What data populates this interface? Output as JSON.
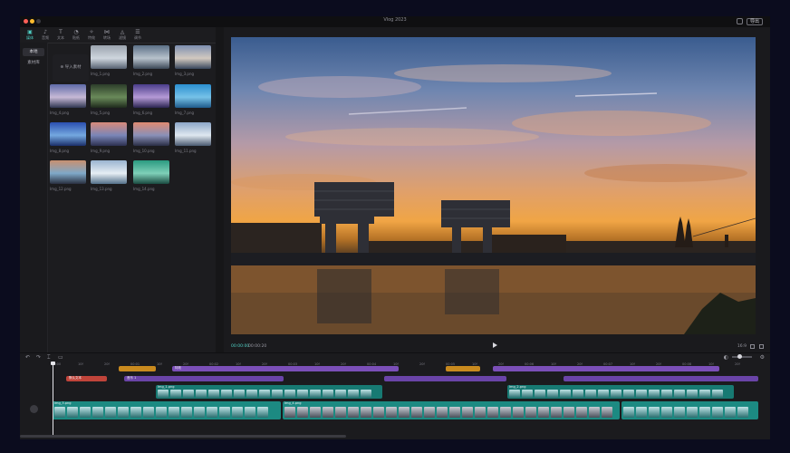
{
  "window": {
    "title": "Vlog 2023",
    "export_label": "导出"
  },
  "media": {
    "tabs": [
      {
        "label": "媒体",
        "glyph": "▣",
        "icon": "media-icon"
      },
      {
        "label": "音频",
        "glyph": "♪",
        "icon": "audio-icon"
      },
      {
        "label": "文本",
        "glyph": "T",
        "icon": "text-icon"
      },
      {
        "label": "贴纸",
        "glyph": "◔",
        "icon": "sticker-icon"
      },
      {
        "label": "特效",
        "glyph": "✧",
        "icon": "effects-icon"
      },
      {
        "label": "转场",
        "glyph": "⋈",
        "icon": "transition-icon"
      },
      {
        "label": "滤镜",
        "glyph": "◬",
        "icon": "filter-icon"
      },
      {
        "label": "调节",
        "glyph": "☰",
        "icon": "adjust-icon"
      }
    ],
    "side_items": [
      "本地",
      "素材库"
    ],
    "import_label": "导入素材",
    "thumbs": [
      {
        "label": "Img_1.png",
        "colors": [
          "#9aa3ad",
          "#cfd6de",
          "#556070"
        ]
      },
      {
        "label": "Img_2.png",
        "colors": [
          "#5b6f86",
          "#b8c2cc",
          "#3a4655"
        ]
      },
      {
        "label": "Img_3.png",
        "colors": [
          "#7d8fb0",
          "#d2c9c0",
          "#38465c"
        ]
      },
      {
        "label": "Img_4.png",
        "colors": [
          "#5e6aa8",
          "#c7b9d6",
          "#2f3550"
        ]
      },
      {
        "label": "Img_5.png",
        "colors": [
          "#2c3d2a",
          "#6a8a5a",
          "#1e2a1c"
        ]
      },
      {
        "label": "Img_6.png",
        "colors": [
          "#4a3d8a",
          "#b59ad6",
          "#2a2450"
        ]
      },
      {
        "label": "Img_7.png",
        "colors": [
          "#2a8fd0",
          "#76c2e8",
          "#1e5a8a"
        ]
      },
      {
        "label": "Img_8.png",
        "colors": [
          "#2a4fb0",
          "#74a8e0",
          "#1b2f6a"
        ]
      },
      {
        "label": "Img_9.png",
        "colors": [
          "#d88a7a",
          "#7a86b8",
          "#2c3050"
        ]
      },
      {
        "label": "Img_10.png",
        "colors": [
          "#e08a70",
          "#8a90b8",
          "#2a2e45"
        ]
      },
      {
        "label": "Img_11.png",
        "colors": [
          "#8ca6c8",
          "#dfe8f0",
          "#4a5a70"
        ]
      },
      {
        "label": "Img_12.png",
        "colors": [
          "#c89070",
          "#7fa8c8",
          "#2a3040"
        ]
      },
      {
        "label": "Img_13.png",
        "colors": [
          "#9ab4d0",
          "#e6eef4",
          "#54708a"
        ]
      },
      {
        "label": "Img_14.png",
        "colors": [
          "#2a9a80",
          "#7fd0b8",
          "#1a4a40"
        ]
      }
    ]
  },
  "preview": {
    "current_time": "00:00:00",
    "total_time": "00:00:20",
    "ratio": "16:9"
  },
  "timeline": {
    "tools": [
      {
        "glyph": "↶",
        "icon": "undo-icon"
      },
      {
        "glyph": "↷",
        "icon": "redo-icon"
      },
      {
        "glyph": "⌶",
        "icon": "split-icon"
      },
      {
        "glyph": "▭",
        "icon": "delete-icon"
      }
    ],
    "ticks": [
      "00:00",
      "10f",
      "20f",
      "00:01",
      "10f",
      "20f",
      "00:02",
      "10f",
      "20f",
      "00:03",
      "10f",
      "20f",
      "00:04",
      "10f",
      "20f",
      "00:05",
      "10f",
      "20f",
      "00:06",
      "10f",
      "20f",
      "00:07",
      "10f",
      "20f",
      "00:08",
      "10f",
      "20f"
    ],
    "track1_label": "Img_1.png",
    "track2_label": "Img_2.png",
    "main_label": "Img_3.png",
    "main_label2": "Img_4.png",
    "text_clip": "默认文本",
    "pink_clip": "音乐 1",
    "purple_clip": "特效"
  },
  "colors": {
    "accent": "#4fd1c5",
    "purple": "#7b4fb8",
    "orange": "#c98a1e",
    "red": "#c0443a",
    "teal": "#177a73"
  }
}
